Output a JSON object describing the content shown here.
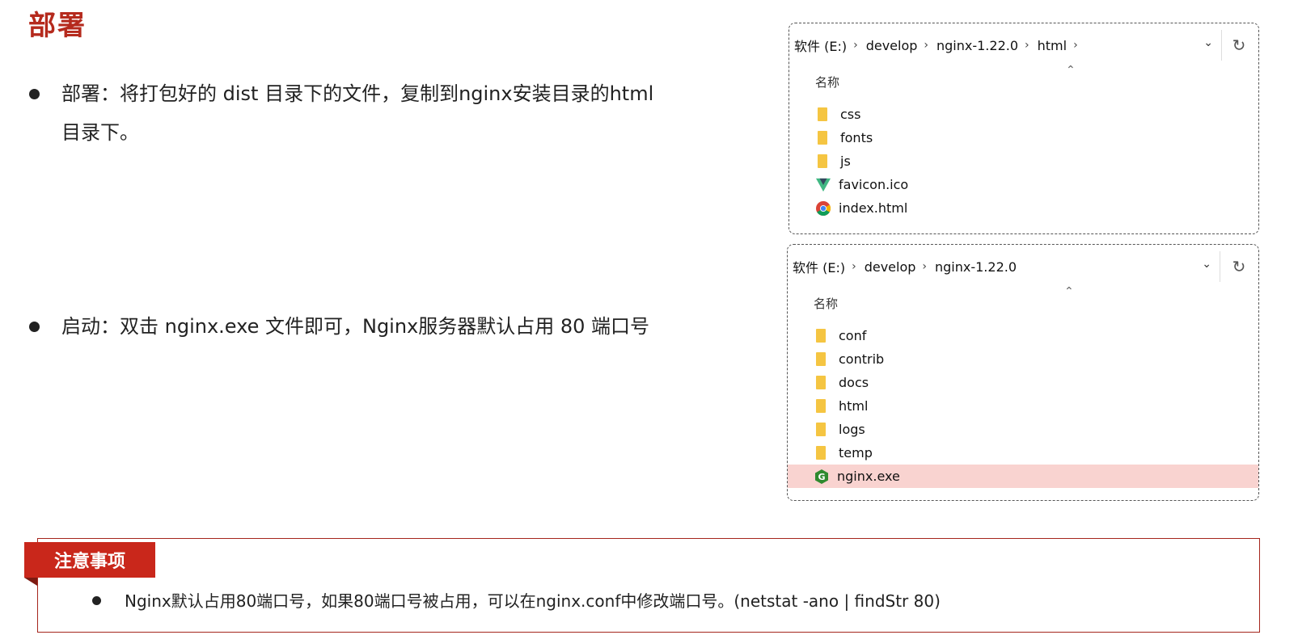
{
  "slide": {
    "title": "部署",
    "bullets": [
      {
        "text": "部署：将打包好的 dist 目录下的文件，复制到nginx安装目录的html目录下。"
      },
      {
        "text": "启动：双击 nginx.exe 文件即可，Nginx服务器默认占用 80 端口号"
      }
    ]
  },
  "explorer_html": {
    "breadcrumb": [
      "软件 (E:)",
      "develop",
      "nginx-1.22.0",
      "html"
    ],
    "column_header": "名称",
    "files": [
      {
        "name": "css",
        "icon": "folder-icon"
      },
      {
        "name": "fonts",
        "icon": "folder-icon"
      },
      {
        "name": "js",
        "icon": "folder-icon"
      },
      {
        "name": "favicon.ico",
        "icon": "vue-logo-icon"
      },
      {
        "name": "index.html",
        "icon": "chrome-icon"
      }
    ]
  },
  "explorer_nginx": {
    "breadcrumb": [
      "软件 (E:)",
      "develop",
      "nginx-1.22.0"
    ],
    "column_header": "名称",
    "files": [
      {
        "name": "conf",
        "icon": "folder-icon"
      },
      {
        "name": "contrib",
        "icon": "folder-icon"
      },
      {
        "name": "docs",
        "icon": "folder-icon"
      },
      {
        "name": "html",
        "icon": "folder-icon"
      },
      {
        "name": "logs",
        "icon": "folder-icon"
      },
      {
        "name": "temp",
        "icon": "folder-icon"
      },
      {
        "name": "nginx.exe",
        "icon": "nginx-icon",
        "selected": true
      }
    ]
  },
  "notice": {
    "tag": "注意事项",
    "text": "Nginx默认占用80端口号，如果80端口号被占用，可以在nginx.conf中修改端口号。(netstat -ano | findStr  80)"
  },
  "colors": {
    "title": "#b52a1d",
    "notice_tag_bg": "#c9271b",
    "selected_row": "#f9d3d0",
    "folder": "#f5c542"
  }
}
